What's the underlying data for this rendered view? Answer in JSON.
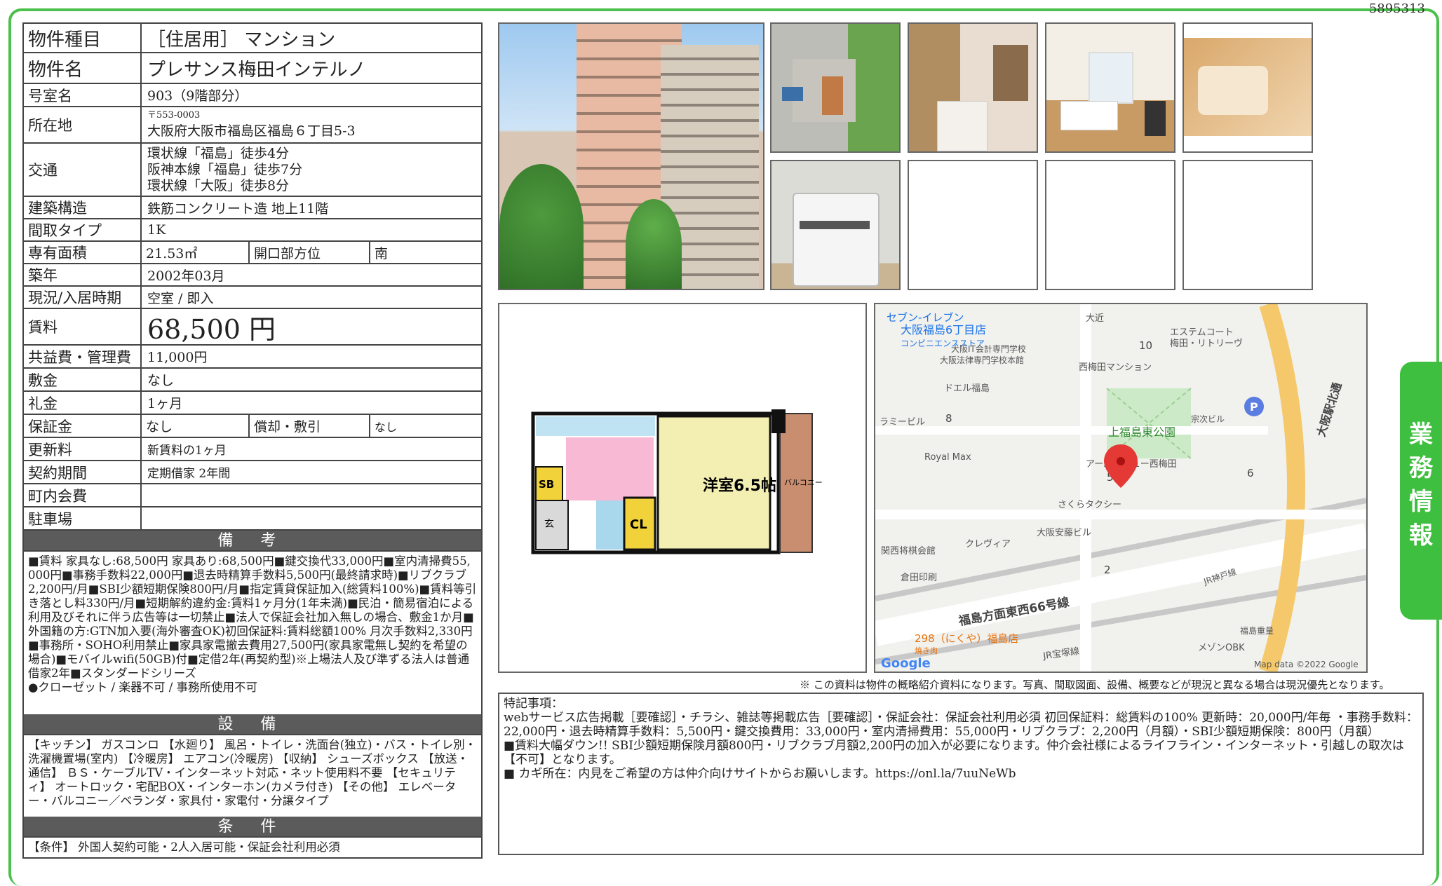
{
  "doc_id": "5895313",
  "rows": {
    "type": {
      "label": "物件種目",
      "value": "［住居用］ マンション"
    },
    "name": {
      "label": "物件名",
      "value": "プレサンス梅田インテルノ"
    },
    "room": {
      "label": "号室名",
      "value": "903（9階部分）"
    },
    "address": {
      "label": "所在地",
      "zip": "〒553-0003",
      "value": "大阪府大阪市福島区福島６丁目5-3"
    },
    "access": {
      "label": "交通",
      "lines": [
        "環状線「福島」徒歩4分",
        "阪神本線「福島」徒歩7分",
        "環状線「大阪」徒歩8分"
      ]
    },
    "structure": {
      "label": "建築構造",
      "value": "鉄筋コンクリート造 地上11階"
    },
    "layout": {
      "label": "間取タイプ",
      "value": "1K"
    },
    "area": {
      "label": "専有面積",
      "value": "21.53㎡",
      "dir_label": "開口部方位",
      "dir_value": "南"
    },
    "built": {
      "label": "築年",
      "value": "2002年03月"
    },
    "status": {
      "label": "現況/入居時期",
      "value": "空室 / 即入"
    },
    "rent": {
      "label": "賃料",
      "value": "68,500 円"
    },
    "fee": {
      "label": "共益費・管理費",
      "value": "11,000円"
    },
    "deposit": {
      "label": "敷金",
      "value": "なし"
    },
    "key_money": {
      "label": "礼金",
      "value": "1ヶ月"
    },
    "guarantee": {
      "label": "保証金",
      "value": "なし",
      "sub_label": "償却・敷引",
      "sub_value": "なし"
    },
    "renewal": {
      "label": "更新料",
      "value": "新賃料の1ヶ月"
    },
    "contract": {
      "label": "契約期間",
      "value": "定期借家 2年間"
    },
    "community": {
      "label": "町内会費",
      "value": ""
    },
    "parking": {
      "label": "駐車場",
      "value": ""
    }
  },
  "sections": {
    "remarks_title": "備 考",
    "remarks": "■賃料 家具なし:68,500円 家具あり:68,500円■鍵交換代33,000円■室内清掃費55,000円■事務手数料22,000円■退去時精算手数料5,500円(最終請求時)■リブクラブ2,200円/月■SBI少額短期保険800円/月■指定賃貸保証加入(総賃料100%)■賃料等引き落とし料330円/月■短期解約違約金:賃料1ヶ月分(1年未満)■民泊・簡易宿泊による利用及びそれに伴う広告等は一切禁止■法人で保証会社加入無しの場合、敷金1か月■外国籍の方:GTN加入要(海外審査OK)初回保証料:賃料総額100% 月次手数料2,330円■事務所・SOHO利用禁止■家具家電撤去費用27,500円(家具家電無し契約を希望の場合)■モバイルwifi(50GB)付■定借2年(再契約型)※上場法人及び準ずる法人は普通借家2年■スタンダードシリーズ\n●クローゼット / 楽器不可 / 事務所使用不可",
    "equipment_title": "設 備",
    "equipment": "【キッチン】 ガスコンロ 【水廻り】 風呂・トイレ・洗面台(独立)・バス・トイレ別・洗濯機置場(室内) 【冷暖房】 エアコン(冷暖房) 【収納】 シューズボックス 【放送・通信】 ＢＳ・ケーブルTV・インターネット対応・ネット使用料不要 【セキュリティ】 オートロック・宅配BOX・インターホン(カメラ付き) 【その他】 エレベーター・バルコニー／ベランダ・家具付・家電付・分譲タイプ",
    "conditions_title": "条 件",
    "conditions": "【条件】 外国人契約可能・2人入居可能・保証会社利用必須"
  },
  "floorplan": {
    "room_label": "洋室6.5帖",
    "balcony": "バルコニー",
    "sb": "SB",
    "cl": "CL",
    "entry": "玄"
  },
  "map": {
    "labels": [
      "セブン-イレブン",
      "大阪福島6丁目店",
      "コンビニエンスストア",
      "大近",
      "エステムコート",
      "梅田・リトリーヴ",
      "10",
      "大阪IT会計専門学校",
      "大阪法律専門学校本館",
      "西梅田マンション",
      "ドエル福島",
      "上福島東公園",
      "宗次ビル",
      "ラミービル",
      "8",
      "Royal Max",
      "アーバンビュー西梅田",
      "5",
      "6",
      "さくらタクシー",
      "大阪安藤ビル",
      "関西将棋会館",
      "クレヴィア",
      "2",
      "倉田印刷",
      "福島方面東西66号線",
      "JR神戸線",
      "298（にくや）福島店",
      "焼き肉",
      "JR宝塚線",
      "メゾンOBK",
      "福島重量",
      "大阪駅北通",
      "Google",
      "Map data ©2022 Google"
    ],
    "accent": "#e53935"
  },
  "disclaimer": "※ この資料は物件の概略紹介資料になります。写真、間取図面、設備、概要などが現況と異なる場合は現況優先となります。",
  "special": "特記事項：\nwebサービス広告掲載［要確認］・チラシ、雑誌等掲載広告［要確認］・保証会社：保証会社利用必須 初回保証料：総賃料の100% 更新時：20,000円/年毎 ・事務手数料：22,000円・退去時精算手数料：5,500円・鍵交換費用：33,000円・室内清掃費用：55,000円・リブクラブ：2,200円（月額）・SBI少額短期保険：800円（月額）\n■賃料大幅ダウン!! SBI少額短期保険月額800円・リブクラブ月額2,200円の加入が必要になります。仲介会社様によるライフライン・インターネット・引越しの取次は【不可】となります。\n■ カギ所在：内見をご希望の方は仲介向けサイトからお願いします。https://onl.la/7uuNeWb",
  "side_tab": [
    "業",
    "務",
    "情",
    "報"
  ],
  "colors": {
    "frame": "#4cc04c",
    "header_bg": "#5b5b5b"
  }
}
